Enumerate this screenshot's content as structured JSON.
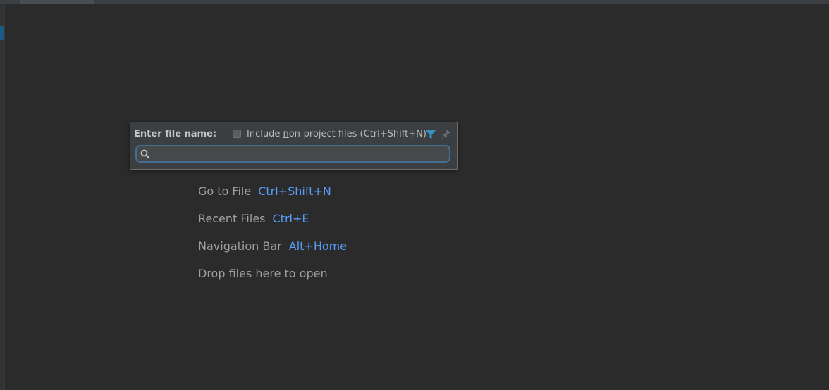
{
  "popup": {
    "title": "Enter file name:",
    "include_checkbox": {
      "checked": false,
      "label_before": "Include ",
      "label_mnemonic": "n",
      "label_after": "on-project files (Ctrl+Shift+N)"
    },
    "filter_icon": "filter-icon",
    "pin_icon": "pin-icon",
    "search": {
      "value": "",
      "placeholder": "",
      "icon": "search-icon"
    },
    "colors": {
      "filter_active": "#3592c4",
      "focus_border": "#466d94"
    }
  },
  "hints": [
    {
      "label": "Go to File",
      "shortcut": "Ctrl+Shift+N"
    },
    {
      "label": "Recent Files",
      "shortcut": "Ctrl+E"
    },
    {
      "label": "Navigation Bar",
      "shortcut": "Alt+Home"
    },
    {
      "label": "Drop files here to open",
      "shortcut": ""
    }
  ],
  "colors": {
    "background": "#2b2b2b",
    "shortcut": "#589df6",
    "hint_text": "#a0a0a0"
  }
}
